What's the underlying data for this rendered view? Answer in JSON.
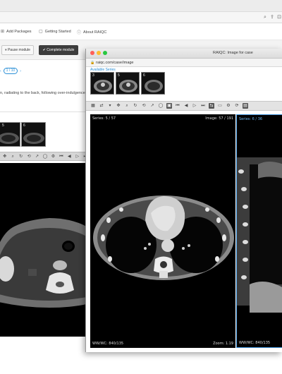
{
  "back_window": {
    "nav": {
      "add_packages": "Add Packages",
      "getting_started": "Getting Started",
      "about": "About RAIQC"
    },
    "toolbar": {
      "pause": "Pause module",
      "complete": "Complete module"
    },
    "pager": {
      "current": "1 / 10"
    },
    "description": "n, radiating to the back, following over-indulgence",
    "thumbnails": [
      {
        "number": "5"
      },
      {
        "number": "6"
      }
    ]
  },
  "front_window": {
    "title": "RAIQC: Image for case",
    "url": "raiqc.com/case/image",
    "available_series_label": "Available Series",
    "thumbnails": [
      {
        "number": "3"
      },
      {
        "number": "5"
      },
      {
        "number": "6"
      }
    ],
    "viewer_left": {
      "series": "Series: 5 / 57",
      "image": "Image: 57 / 191",
      "wwwc": "WW/WC: 840/135",
      "zoom": "Zoom: 1.19"
    },
    "viewer_right": {
      "series": "Series: 6 / 36",
      "wwwc": "WW/WC: 840/135"
    }
  },
  "colors": {
    "accent": "#2a8fd6",
    "dark_button": "#3d3d3d",
    "viewer_bg": "#000000",
    "active_viewport_border": "#3a8fd6"
  },
  "icons": [
    "search-icon",
    "share-icon",
    "extension-icon",
    "package-icon",
    "info-icon",
    "pause-icon",
    "check-icon",
    "lock-icon",
    "window-close",
    "window-minimize",
    "window-maximize"
  ]
}
